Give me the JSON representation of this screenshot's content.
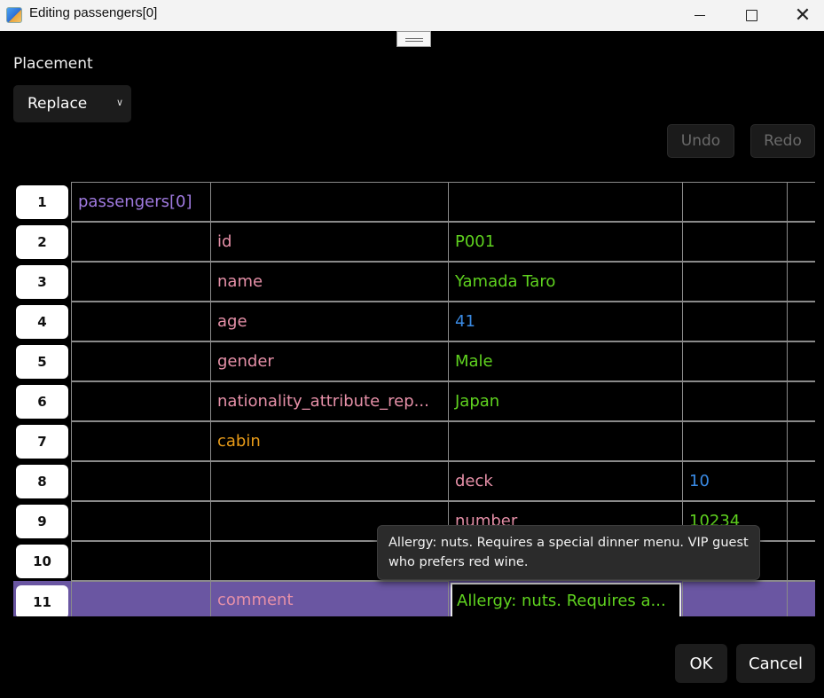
{
  "window": {
    "title": "Editing passengers[0]",
    "controls": [
      "minimize-icon",
      "maximize-icon",
      "close-icon"
    ]
  },
  "placement": {
    "label": "Placement",
    "selected": "Replace"
  },
  "toolbar": {
    "undo": "Undo",
    "redo": "Redo"
  },
  "grid": {
    "rows": [
      {
        "num": "1",
        "cells": [
          "passengers[0]",
          "",
          "",
          ""
        ]
      },
      {
        "num": "2",
        "cells": [
          "",
          "id",
          "P001",
          ""
        ]
      },
      {
        "num": "3",
        "cells": [
          "",
          "name",
          "Yamada Taro",
          ""
        ]
      },
      {
        "num": "4",
        "cells": [
          "",
          "age",
          "41",
          ""
        ]
      },
      {
        "num": "5",
        "cells": [
          "",
          "gender",
          "Male",
          ""
        ]
      },
      {
        "num": "6",
        "cells": [
          "",
          "nationality_attribute_rep...",
          "Japan",
          ""
        ]
      },
      {
        "num": "7",
        "cells": [
          "",
          "cabin",
          "",
          ""
        ]
      },
      {
        "num": "8",
        "cells": [
          "",
          "",
          "deck",
          "10"
        ]
      },
      {
        "num": "9",
        "cells": [
          "",
          "",
          "number",
          "10234"
        ]
      },
      {
        "num": "10",
        "cells": [
          "",
          "",
          "",
          ""
        ]
      },
      {
        "num": "11",
        "cells": [
          "",
          "comment",
          "Allergy: nuts. Requires a...",
          ""
        ]
      }
    ]
  },
  "tooltip": {
    "line1": "Allergy: nuts. Requires a special dinner menu. VIP guest",
    "line2": "who prefers red wine."
  },
  "footer": {
    "ok": "OK",
    "cancel": "Cancel"
  },
  "colors": {
    "key": "#e690a8",
    "string": "#5fd21f",
    "number": "#3a8be5",
    "object": "#e79a18",
    "root": "#a07ae0",
    "selection": "#6a56a2"
  }
}
